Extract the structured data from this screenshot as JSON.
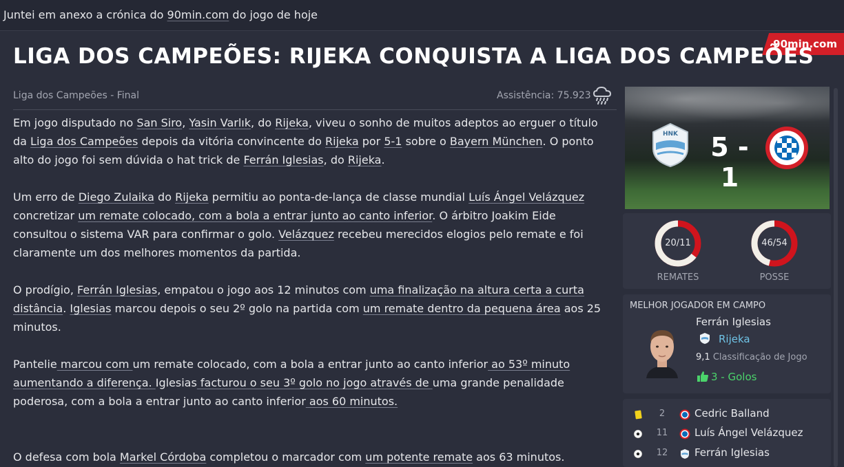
{
  "topbar": {
    "text_before": "Juntei em anexo a crónica do ",
    "link": "90min.com",
    "text_after": " do jogo de hoje"
  },
  "source_badge": "90min.com",
  "headline": "LIGA DOS CAMPEÕES: RIJEKA CONQUISTA A LIGA DOS CAMPEÕES",
  "meta": {
    "competition": "Liga dos Campeões - Final",
    "attendance": "Assistência: 75.923",
    "weather_icon": "rain-cloud-icon"
  },
  "article": {
    "p1": [
      "Em jogo disputado no ",
      "San Siro",
      ", ",
      "Yasin Varlık",
      ", do ",
      "Rijeka",
      ", viveu o sonho de muitos adeptos ao erguer o título da ",
      "Liga dos Campeões",
      " depois da vitória convincente do ",
      "Rijeka",
      " por ",
      "5-1",
      " sobre o ",
      "Bayern München",
      ". O ponto alto do jogo foi sem dúvida o hat trick de ",
      "Ferrán Iglesias",
      ", do ",
      "Rijeka",
      "."
    ],
    "p2": [
      "Um erro de ",
      "Diego Zulaika",
      " do ",
      "Rijeka",
      " permitiu ao ponta-de-lança de classe mundial ",
      "Luís Ángel Velázquez",
      " concretizar ",
      "um remate colocado, com a bola a entrar junto ao canto inferior",
      ". O árbitro Joakim Eide consultou o sistema VAR para confirmar o golo. ",
      "Velázquez",
      " recebeu merecidos elogios pelo remate e foi claramente um dos melhores momentos da partida."
    ],
    "p3": [
      "O prodígio, ",
      "Ferrán Iglesias",
      ", empatou o jogo aos 12 minutos com ",
      "uma finalização na altura certa a curta distância",
      ". ",
      "Iglesias",
      " marcou depois o seu 2º golo na partida com ",
      "um remate dentro da pequena área",
      " aos 25 minutos."
    ],
    "p4": [
      "Pantelie",
      " marcou com ",
      "um remate colocado, com a bola a entrar junto ao canto inferior",
      " ao 53º minuto aumentando a diferença. ",
      "Iglesias",
      " facturou o seu 3º golo no jogo através de ",
      "uma grande penalidade poderosa, com a bola a entrar junto ao canto inferior",
      " aos 60 minutos."
    ],
    "p5": [
      "O defesa com bola ",
      "Markel Córdoba",
      " completou o marcador com ",
      "um potente remate",
      " aos 63 minutos."
    ]
  },
  "scoreboard": {
    "home_crest": "rijeka-crest-icon",
    "away_crest": "bayern-crest-icon",
    "score": "5 - 1"
  },
  "stats": {
    "shots": {
      "value": "20/11",
      "label": "REMATES",
      "home_share": 0.645
    },
    "possession": {
      "value": "46/54",
      "label": "POSSE",
      "home_share": 0.46
    }
  },
  "potm": {
    "title": "MELHOR JOGADOR EM CAMPO",
    "name": "Ferrán Iglesias",
    "club": "Rijeka",
    "rating_value": "9,1",
    "rating_label": "Classificação de Jogo",
    "goals": "3 - Golos"
  },
  "events": [
    {
      "icon": "yellow-card-icon",
      "minute": "2",
      "crest": "bayern-crest-icon",
      "name": "Cedric Balland"
    },
    {
      "icon": "ball-icon",
      "minute": "11",
      "crest": "bayern-crest-icon",
      "name": "Luís Ángel Velázquez"
    },
    {
      "icon": "ball-icon",
      "minute": "12",
      "crest": "rijeka-crest-icon",
      "name": "Ferrán Iglesias"
    }
  ],
  "colors": {
    "accent_red": "#d31f28",
    "home_ring": "#f2efe8",
    "away_ring": "#d0141d",
    "link_blue": "#6fc3e6",
    "goals_green": "#4bd36b"
  }
}
